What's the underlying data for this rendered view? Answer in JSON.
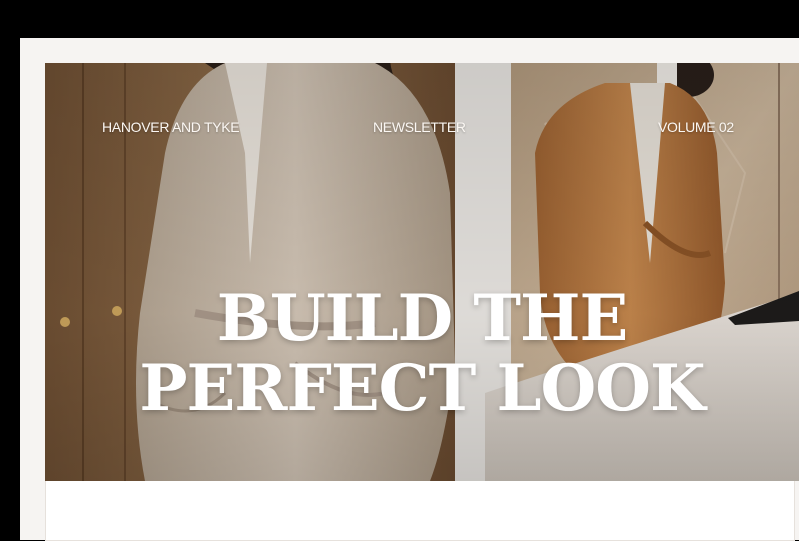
{
  "nav": {
    "brand": "HANOVER AND TYKE",
    "newsletter": "NEWSLETTER",
    "volume": "VOLUME 02"
  },
  "hero": {
    "headline_line1": "BUILD THE",
    "headline_line2": "PERFECT LOOK"
  },
  "colors": {
    "background": "#000000",
    "page": "#f6f4f2",
    "headline": "#ffffff",
    "cardigan_left": "#c9bcac",
    "cardigan_right": "#b77a42",
    "wood": "#8a6a48"
  }
}
